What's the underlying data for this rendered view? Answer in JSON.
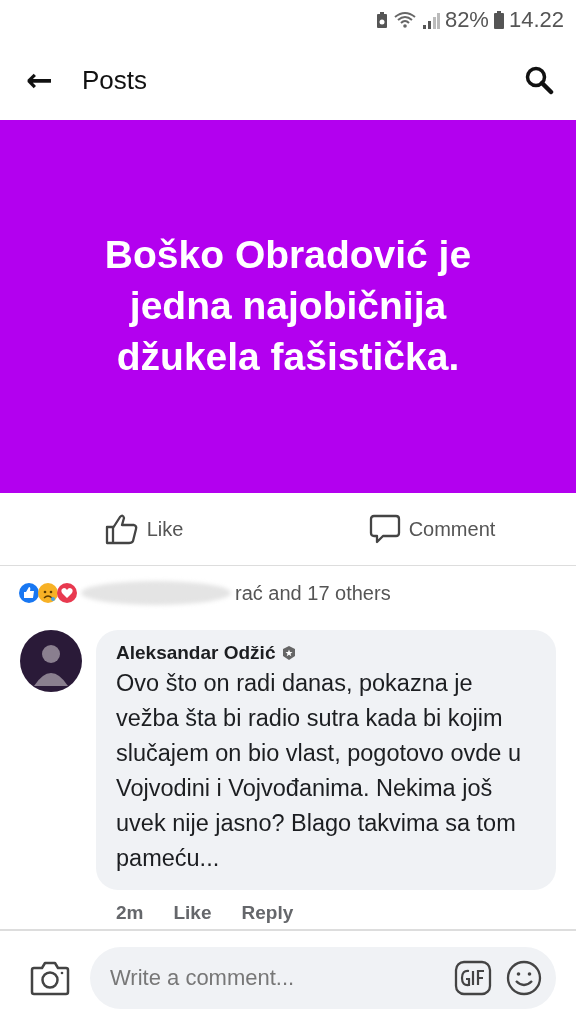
{
  "status_bar": {
    "battery": "82%",
    "time": "14.22"
  },
  "header": {
    "back": "←",
    "title": "Posts"
  },
  "post": {
    "text": "Boško Obradović je jedna najobičnija džukela fašistička."
  },
  "actions": [
    {
      "kind": "like",
      "label": "Like"
    },
    {
      "kind": "comment",
      "label": "Comment"
    }
  ],
  "reactions": {
    "summary": "rać and 17 others"
  },
  "comment": {
    "author": "Aleksandar Odžić",
    "text": "Ovo što on radi danas, pokazna je vežba šta bi radio sutra kada bi kojim slučajem on bio vlast, pogotovo ovde u Vojvodini i Vojvođanima. Nekima još uvek nije jasno? Blago takvima sa tom pameću...",
    "time": "2m",
    "like": "Like",
    "reply": "Reply"
  },
  "composer": {
    "placeholder": "Write a comment..."
  }
}
